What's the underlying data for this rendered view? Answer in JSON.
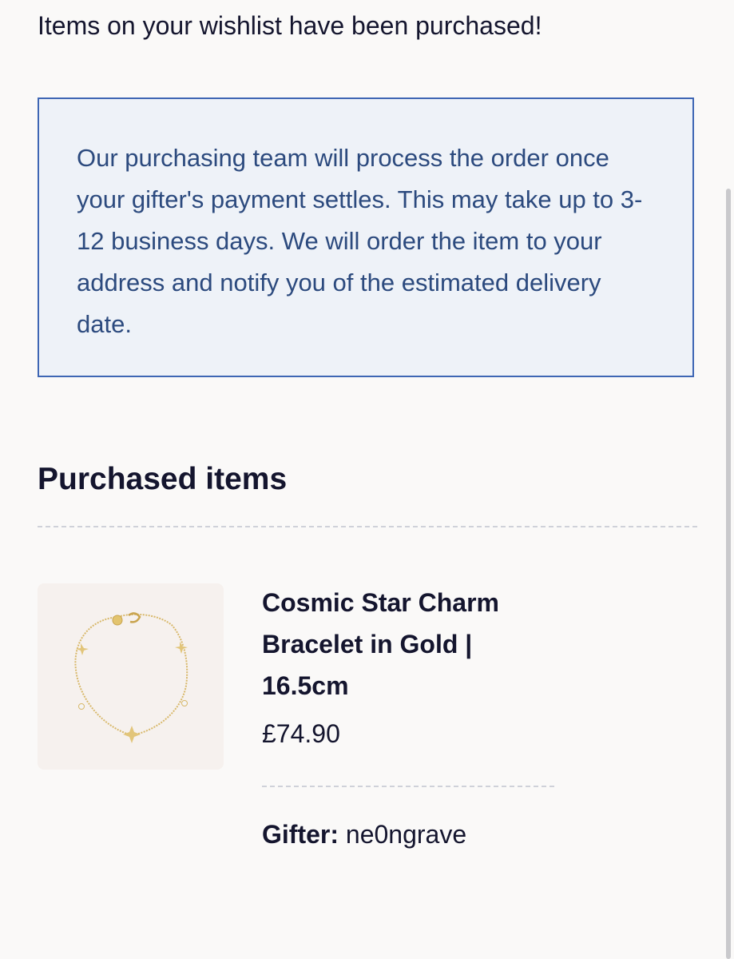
{
  "header": {
    "message": "Items on your wishlist have been purchased!"
  },
  "notice": {
    "text": "Our purchasing team will process the order once your gifter's payment settles. This may take up to 3-12 business days. We will order the item to your address and notify you of the estimated delivery date."
  },
  "purchased": {
    "title": "Purchased items",
    "items": [
      {
        "name": "Cosmic Star Charm Bracelet in Gold | 16.5cm",
        "price": "£74.90",
        "gifter_label": "Gifter:",
        "gifter_name": "ne0ngrave",
        "image_icon": "bracelet-image"
      }
    ]
  },
  "colors": {
    "background": "#faf9f8",
    "notice_bg": "#eef2f8",
    "notice_border": "#3e66b4",
    "notice_text": "#2c4a7e",
    "text_primary": "#14152e",
    "divider": "#cfd1d9",
    "gold": "#d8b86a"
  }
}
